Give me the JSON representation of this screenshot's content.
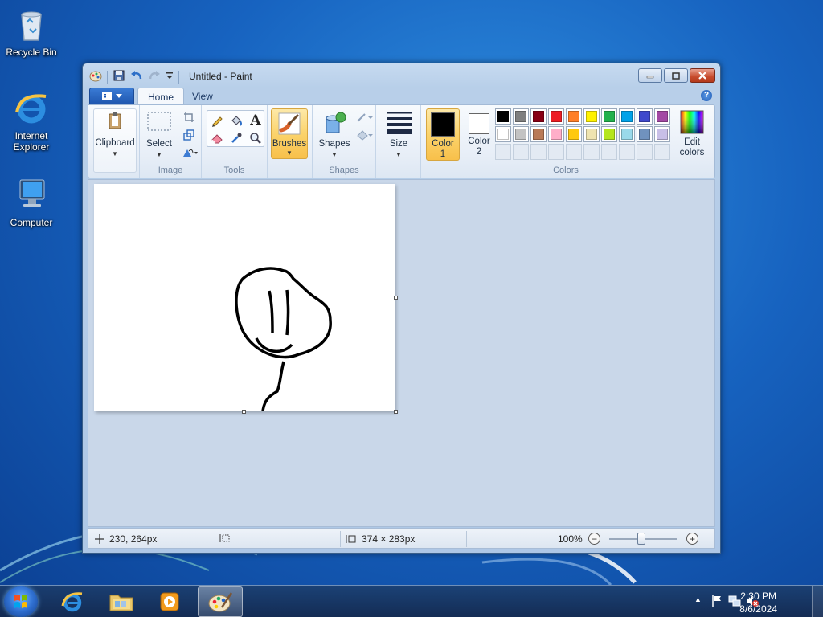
{
  "desktop": {
    "icons": [
      {
        "label": "Recycle Bin",
        "icon": "recycle-bin-icon"
      },
      {
        "label": "Internet Explorer",
        "icon": "internet-explorer-icon"
      },
      {
        "label": "Computer",
        "icon": "computer-icon"
      }
    ]
  },
  "window": {
    "title": "Untitled - Paint",
    "tabs": [
      {
        "label": "Home"
      },
      {
        "label": "View"
      }
    ],
    "help": "?",
    "groups": {
      "clipboard": {
        "button": "Clipboard"
      },
      "image": {
        "label": "Image",
        "select": "Select"
      },
      "tools": {
        "label": "Tools",
        "text_tool": "A"
      },
      "brushes": {
        "button": "Brushes"
      },
      "shapes": {
        "label": "Shapes",
        "button": "Shapes"
      },
      "size": {
        "button": "Size"
      },
      "colors": {
        "label": "Colors",
        "color1": {
          "line1": "Color",
          "line2": "1",
          "value": "#000000"
        },
        "color2": {
          "line1": "Color",
          "line2": "2",
          "value": "#ffffff"
        },
        "edit": {
          "line1": "Edit",
          "line2": "colors"
        },
        "palette_row1": [
          "#000000",
          "#7f7f7f",
          "#880015",
          "#ed1c24",
          "#ff7f27",
          "#fff200",
          "#22b14c",
          "#00a2e8",
          "#3f48cc",
          "#a349a4"
        ],
        "palette_row2": [
          "#ffffff",
          "#c3c3c3",
          "#b97a57",
          "#ffaec9",
          "#ffc90e",
          "#efe4b0",
          "#b5e61d",
          "#99d9ea",
          "#7092be",
          "#c8bfe7"
        ],
        "palette_row3_count": 10
      }
    },
    "status": {
      "cursor_pos": "230, 264px",
      "canvas_size": "374 × 283px",
      "zoom": "100%",
      "zoom_minus": "−",
      "zoom_plus": "+"
    }
  },
  "taskbar": {
    "apps": [
      {
        "name": "internet-explorer",
        "active": false
      },
      {
        "name": "windows-explorer",
        "active": false
      },
      {
        "name": "media-player",
        "active": false
      },
      {
        "name": "paint",
        "active": true
      }
    ],
    "tray": {
      "time": "2:30 PM",
      "date": "8/6/2024",
      "show_hidden": "▲"
    }
  }
}
